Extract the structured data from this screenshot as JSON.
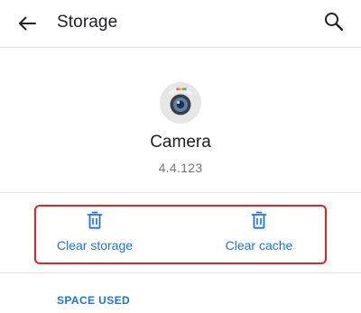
{
  "app_bar": {
    "title": "Storage",
    "back_icon": "arrow-left-icon",
    "search_icon": "search-icon"
  },
  "app": {
    "name": "Camera",
    "version": "4.4.123",
    "icon": "camera-app-icon"
  },
  "actions": {
    "clear_storage_label": "Clear storage",
    "clear_cache_label": "Clear cache",
    "icon": "trash-icon"
  },
  "sections": {
    "space_used_header": "SPACE USED"
  },
  "colors": {
    "accent": "#1a73e8",
    "highlight": "#e02424",
    "divider": "#e3e3e3",
    "text_primary": "#202124",
    "text_secondary": "#757575"
  }
}
